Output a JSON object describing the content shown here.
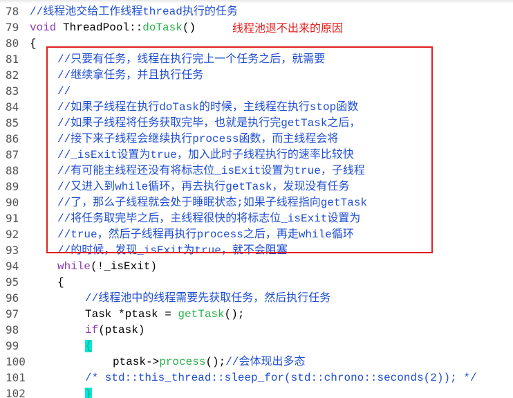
{
  "annotation": "线程池退不出来的原因",
  "colors": {
    "comment": "#1f4ed0",
    "keyword": "#8a3bb0",
    "function": "#2bb34a",
    "line_number": "#555555",
    "annotation": "#e81a1a",
    "highlight_box": "#e02020",
    "brace_highlight": "#00e5e5"
  },
  "lines": [
    {
      "num": "78",
      "indent": 0,
      "parts": [
        {
          "t": "//线程池交给工作线程thread执行的任务",
          "c": "cm"
        }
      ]
    },
    {
      "num": "79",
      "indent": 0,
      "parts": [
        {
          "t": "void",
          "c": "kw"
        },
        {
          "t": " ThreadPool::",
          "c": ""
        },
        {
          "t": "doTask",
          "c": "fn"
        },
        {
          "t": "()",
          "c": ""
        }
      ]
    },
    {
      "num": "80",
      "indent": 0,
      "parts": [
        {
          "t": "{",
          "c": ""
        }
      ]
    },
    {
      "num": "81",
      "indent": 1,
      "parts": [
        {
          "t": "//只要有任务，线程在执行完上一个任务之后，就需要",
          "c": "cm"
        }
      ]
    },
    {
      "num": "82",
      "indent": 1,
      "parts": [
        {
          "t": "//继续拿任务，并且执行任务",
          "c": "cm"
        }
      ]
    },
    {
      "num": "83",
      "indent": 1,
      "parts": [
        {
          "t": "//",
          "c": "cm"
        }
      ]
    },
    {
      "num": "84",
      "indent": 1,
      "parts": [
        {
          "t": "//如果子线程在执行doTask的时候，主线程在执行stop函数",
          "c": "cm"
        }
      ]
    },
    {
      "num": "85",
      "indent": 1,
      "parts": [
        {
          "t": "//如果子线程将任务获取完毕，也就是执行完getTask之后，",
          "c": "cm"
        }
      ]
    },
    {
      "num": "86",
      "indent": 1,
      "parts": [
        {
          "t": "//接下来子线程会继续执行process函数，而主线程会将",
          "c": "cm"
        }
      ]
    },
    {
      "num": "87",
      "indent": 1,
      "parts": [
        {
          "t": "//_isExit设置为true，加入此时子线程执行的速率比较快",
          "c": "cm"
        }
      ]
    },
    {
      "num": "88",
      "indent": 1,
      "parts": [
        {
          "t": "//有可能主线程还没有将标志位_isExit设置为true，子线程",
          "c": "cm"
        }
      ]
    },
    {
      "num": "89",
      "indent": 1,
      "parts": [
        {
          "t": "//又进入到while循环，再去执行getTask，发现没有任务",
          "c": "cm"
        }
      ]
    },
    {
      "num": "90",
      "indent": 1,
      "parts": [
        {
          "t": "//了，那么子线程就会处于睡眠状态;如果子线程指向getTask",
          "c": "cm"
        }
      ]
    },
    {
      "num": "91",
      "indent": 1,
      "parts": [
        {
          "t": "//将任务取完毕之后，主线程很快的将标志位_isExit设置为",
          "c": "cm"
        }
      ]
    },
    {
      "num": "92",
      "indent": 1,
      "parts": [
        {
          "t": "//true，然后子线程再执行process之后，再走while循环",
          "c": "cm"
        }
      ]
    },
    {
      "num": "93",
      "indent": 1,
      "parts": [
        {
          "t": "//的时候，发现_isExit为true，就不会阻塞",
          "c": "cm"
        }
      ]
    },
    {
      "num": "94",
      "indent": 1,
      "parts": [
        {
          "t": "while",
          "c": "kw"
        },
        {
          "t": "(!_isExit)",
          "c": ""
        }
      ]
    },
    {
      "num": "95",
      "indent": 1,
      "parts": [
        {
          "t": "{",
          "c": ""
        }
      ]
    },
    {
      "num": "96",
      "indent": 2,
      "parts": [
        {
          "t": "//线程池中的线程需要先获取任务，然后执行任务",
          "c": "cm"
        }
      ]
    },
    {
      "num": "97",
      "indent": 2,
      "parts": [
        {
          "t": "Task *ptask = ",
          "c": ""
        },
        {
          "t": "getTask",
          "c": "fn"
        },
        {
          "t": "();",
          "c": ""
        }
      ]
    },
    {
      "num": "98",
      "indent": 2,
      "parts": [
        {
          "t": "if",
          "c": "kw"
        },
        {
          "t": "(ptask)",
          "c": ""
        }
      ]
    },
    {
      "num": "99",
      "indent": 2,
      "parts": [
        {
          "t": "{",
          "c": "hl"
        }
      ]
    },
    {
      "num": "100",
      "indent": 3,
      "parts": [
        {
          "t": "ptask->",
          "c": ""
        },
        {
          "t": "process",
          "c": "fn"
        },
        {
          "t": "();",
          "c": ""
        },
        {
          "t": "//会体现出多态",
          "c": "cm"
        }
      ]
    },
    {
      "num": "101",
      "indent": 2,
      "parts": [
        {
          "t": "/* std::this_thread::sleep_for(std::chrono::seconds(2)); */",
          "c": "cm"
        }
      ]
    },
    {
      "num": "102",
      "indent": 2,
      "parts": [
        {
          "t": "}",
          "c": "hl"
        }
      ]
    }
  ]
}
